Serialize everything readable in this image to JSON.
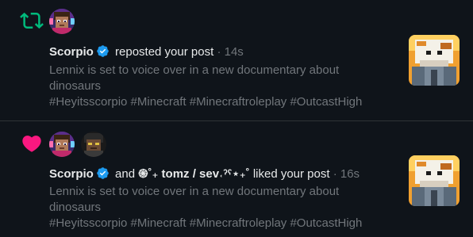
{
  "notifications": [
    {
      "type_icon": "repost-icon",
      "type_color": "#00ba7c",
      "avatars": [
        "scorpio-avatar"
      ],
      "user_name": "Scorpio",
      "action_text": "reposted your post",
      "separator": "·",
      "time": "14s",
      "post_text": "Lennix is set to voice over in a new documentary about dinosaurs",
      "hashtags": "#Heyitsscorpio #Minecraft #Minecraftroleplay #OutcastHigh"
    },
    {
      "type_icon": "heart-icon",
      "type_color": "#f91880",
      "avatars": [
        "scorpio-avatar",
        "tomz-avatar"
      ],
      "user_name": "Scorpio",
      "connector": "and",
      "second_user": "֍˚₊ tomz / sev˓ˀˁ⋆₊˚",
      "action_text": "liked your post",
      "separator": "·",
      "time": "16s",
      "post_text": "Lennix is set to voice over in a new documentary about dinosaurs",
      "hashtags": "#Heyitsscorpio #Minecraft #Minecraftroleplay #OutcastHigh"
    }
  ],
  "colors": {
    "background": "#0f141a",
    "divider": "#2f3336",
    "primary_text": "#e7e9ea",
    "secondary_text": "#71767b",
    "verified_badge": "#1d9bf0"
  }
}
